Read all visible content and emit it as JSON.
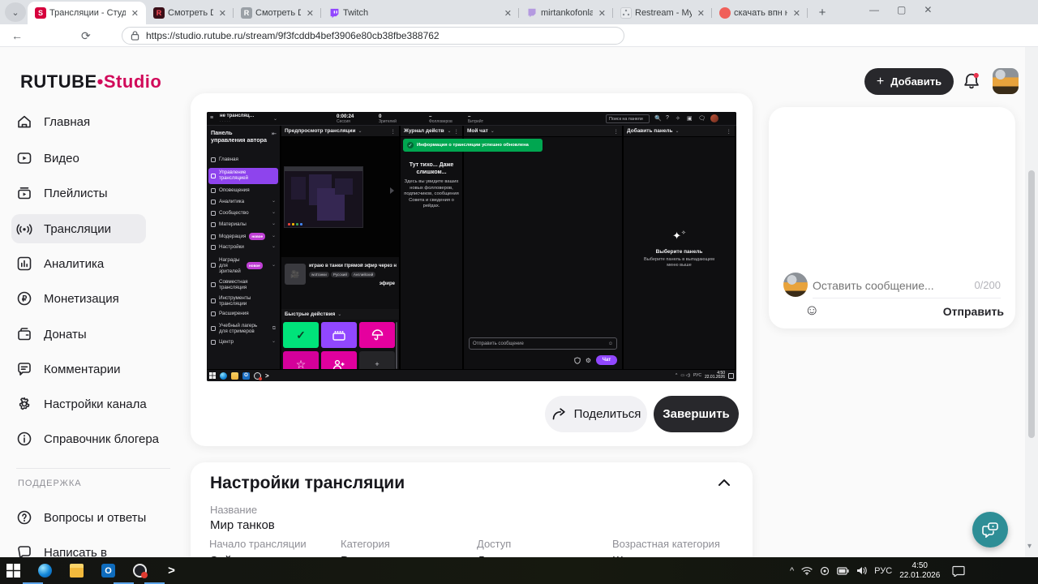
{
  "browser": {
    "tabs": [
      {
        "title": "Трансляции - Студия",
        "favicon": "S"
      },
      {
        "title": "Смотреть DRim Tim |||",
        "favicon": "R"
      },
      {
        "title": "Смотреть DRim Tim |||",
        "favicon": "R"
      },
      {
        "title": "Twitch",
        "favicon": ""
      },
      {
        "title": "mirtankofonlain - Twit",
        "favicon": ""
      },
      {
        "title": "Restream - Мультитра",
        "favicon": ""
      },
      {
        "title": "скачать впн на пк бес",
        "favicon": ""
      }
    ],
    "url": "https://studio.rutube.ru/stream/9f3fcddb4bef3906e80cb38fbe388762"
  },
  "header": {
    "logo_primary": "RUTUBE",
    "logo_dot": "•",
    "logo_secondary": "Studio",
    "add_button": "Добавить"
  },
  "sidebar": {
    "items": [
      {
        "label": "Главная"
      },
      {
        "label": "Видео"
      },
      {
        "label": "Плейлисты"
      },
      {
        "label": "Трансляции"
      },
      {
        "label": "Аналитика"
      },
      {
        "label": "Монетизация"
      },
      {
        "label": "Донаты"
      },
      {
        "label": "Комментарии"
      },
      {
        "label": "Настройки канала"
      },
      {
        "label": "Справочник блогера"
      }
    ],
    "support_label": "ПОДДЕРЖКА",
    "support_items": [
      {
        "label": "Вопросы и ответы"
      },
      {
        "label": "Написать в"
      }
    ]
  },
  "tw": {
    "status": "не трансляц…",
    "metrics": [
      {
        "value": "0:00:24",
        "label": "Сессия"
      },
      {
        "value": "0",
        "label": "Зрителей"
      },
      {
        "value": "–",
        "label": "Фолловеров"
      },
      {
        "value": "–",
        "label": "Битрейт"
      }
    ],
    "search": "Поиск на панели",
    "side_title": "Панель управления автора",
    "side": [
      {
        "label": "Главная"
      },
      {
        "label": "Управление трансляцией"
      },
      {
        "label": "Оповещения"
      },
      {
        "label": "Аналитика"
      },
      {
        "label": "Сообщество"
      },
      {
        "label": "Материалы"
      },
      {
        "label": "Модерация",
        "badge": "новое"
      },
      {
        "label": "Настройки"
      },
      {
        "label": "Награды для зрителей",
        "badge": "новое"
      },
      {
        "label": "Совместная трансляция"
      },
      {
        "label": "Инструменты трансляции"
      },
      {
        "label": "Расширения"
      },
      {
        "label": "Учебный лагерь для стримеров"
      },
      {
        "label": "Центр"
      }
    ],
    "col_preview": "Предпросмотр трансляции",
    "col_journal": "Журнал действий",
    "col_chat": "Мой чат",
    "col_panel": "Добавить панель",
    "toast": "Информация о трансляции успешно обновлена",
    "stream": {
      "title": "играю в танки Прямой эфир через н",
      "tail": "эфире",
      "tags": [
        "wotтанки",
        "Русский",
        "Английский"
      ]
    },
    "quick_actions": "Быстрые действия",
    "journal": {
      "title": "Тут тихо... Даже слишком...",
      "body": "Здесь вы увидите ваших новых фолловеров, подписчиков, сообщения Совета и сведения о рейдах."
    },
    "chat": {
      "placeholder": "Отправить сообщение",
      "button": "Чат"
    },
    "panel": {
      "title": "Выберите панель",
      "body": "Выберите панель в выпадающем меню выше"
    },
    "taskbar": {
      "lang": "РУС",
      "time": "4:50",
      "date": "22.01.2026"
    }
  },
  "main": {
    "share": "Поделиться",
    "finish": "Завершить"
  },
  "settings": {
    "title": "Настройки трансляции",
    "name_label": "Название",
    "name_value": "Мир танков",
    "fields": [
      {
        "label": "Начало трансляции",
        "value": "Сейчас"
      },
      {
        "label": "Категория",
        "value": "Видеоигры"
      },
      {
        "label": "Доступ",
        "value": "Для всех"
      },
      {
        "label": "Возрастная категория",
        "value": "Широкая аудитория"
      }
    ]
  },
  "chat": {
    "placeholder": "Оставить сообщение...",
    "counter": "0/200",
    "send": "Отправить"
  },
  "host_taskbar": {
    "lang": "РУС",
    "time": "4:50",
    "date": "22.01.2026"
  },
  "colors": {
    "rutube_accent": "#d10a5a",
    "twitch_purple": "#9147ff",
    "toast_green": "#00a650",
    "fab_teal": "#2e8e96"
  }
}
